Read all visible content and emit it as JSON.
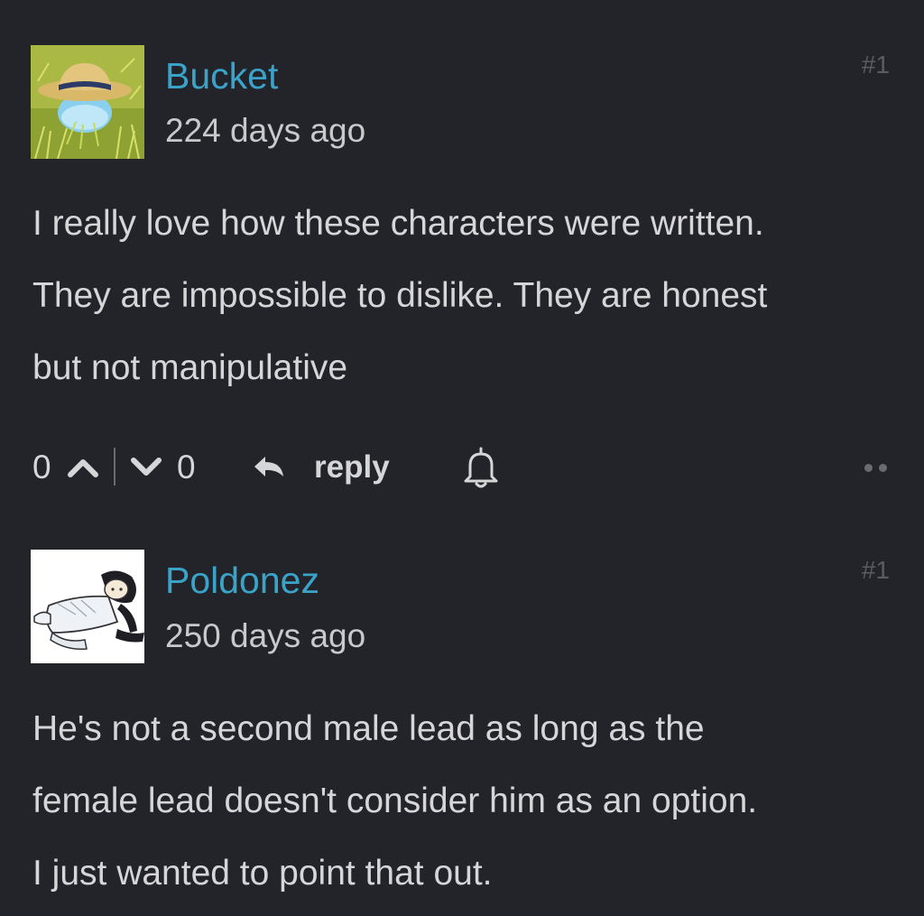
{
  "comments": [
    {
      "author": "Bucket",
      "time": "224 days ago",
      "number": "#1",
      "avatar_icon": "straw-hat-slime-avatar",
      "body_lines": [
        "I really love how these characters were written.",
        "They are impossible to dislike. They are honest",
        "but not manipulative"
      ],
      "upvotes": "0",
      "downvotes": "0",
      "reply_label": "reply",
      "accent": "#3aa3c9"
    },
    {
      "author": "Poldonez",
      "time": "250 days ago",
      "number": "#1",
      "avatar_icon": "lying-character-avatar",
      "body_lines": [
        "He's not a second male lead as long as the",
        "female lead doesn't consider him as an option.",
        "I just wanted to point that out."
      ]
    }
  ],
  "colors": {
    "background": "#232429",
    "author": "#3aa3c9",
    "text": "#d6d6d9",
    "muted": "#5b5c62"
  }
}
